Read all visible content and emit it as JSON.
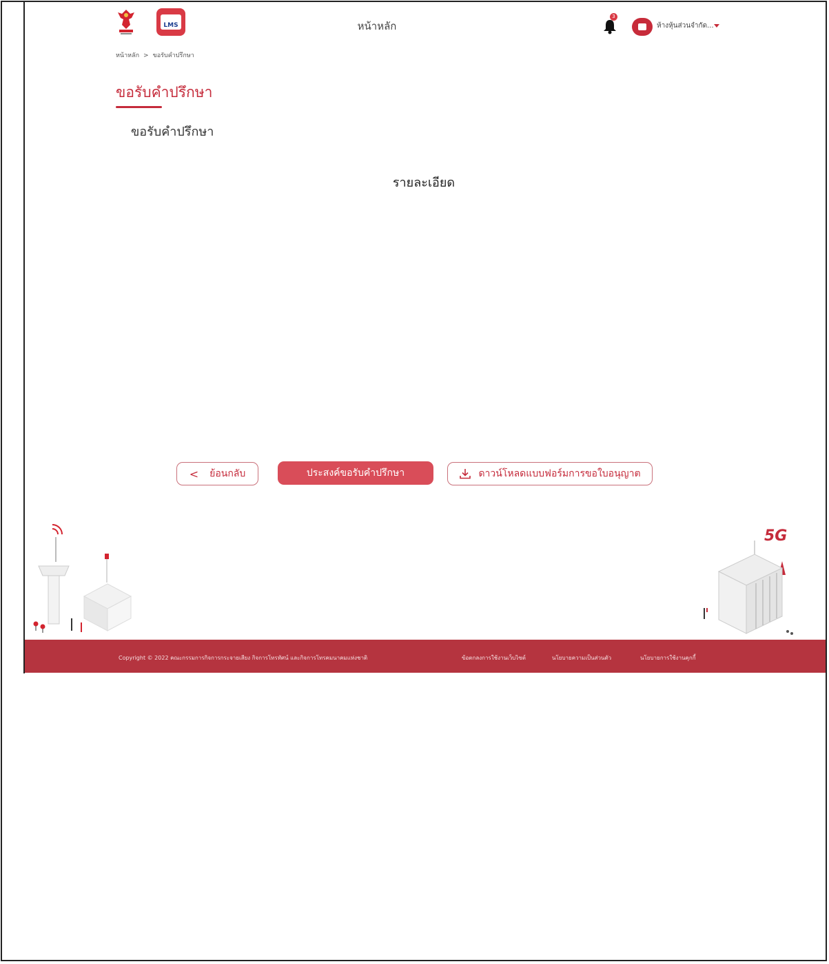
{
  "header": {
    "nav_title": "หน้าหลัก",
    "notification_count": "3",
    "user_name": "ห้างหุ้นส่วนจำกัด..."
  },
  "breadcrumb": {
    "home": "หน้าหลัก",
    "separator": ">",
    "current": "ขอรับคำปรึกษา"
  },
  "page": {
    "title": "ขอรับคำปรึกษา",
    "subtitle": "ขอรับคำปรึกษา",
    "detail_heading": "รายละเอียด"
  },
  "actions": {
    "back_label": "ย้อนกลับ",
    "request_label": "ประสงค์ขอรับคำปรึกษา",
    "download_label": "ดาวน์โหลดแบบฟอร์มการขอใบอนุญาต"
  },
  "footer": {
    "copyright": "Copyright © 2022 คณะกรรมการกิจการกระจายเสียง กิจการโทรทัศน์ และกิจการโทรคมนาคมแห่งชาติ",
    "terms_link": "ข้อตกลงการใช้งานเว็บไซต์",
    "privacy_link": "นโยบายความเป็นส่วนตัว",
    "cookie_link": "นโยบายการใช้งานคุกกี้"
  },
  "illustration": {
    "badge_5g": "5G"
  },
  "colors": {
    "brand_red": "#c52b3b",
    "button_red": "#d94d59",
    "footer_red": "#b5343f"
  }
}
